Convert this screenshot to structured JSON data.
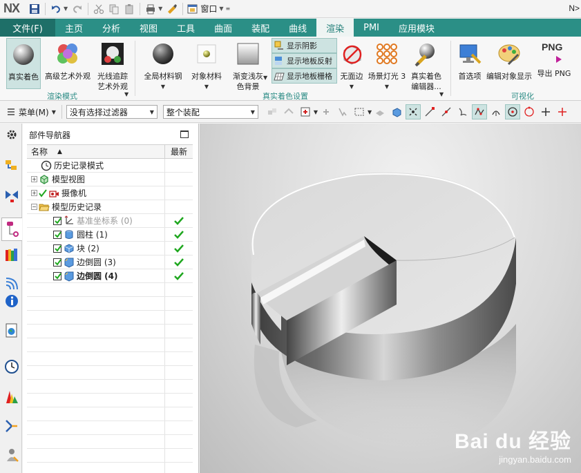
{
  "app": {
    "logo": "NX",
    "title_right": "N>"
  },
  "quick_access": {
    "window_menu": "窗口"
  },
  "tabs": [
    {
      "label": "文件(F)"
    },
    {
      "label": "主页"
    },
    {
      "label": "分析"
    },
    {
      "label": "视图"
    },
    {
      "label": "工具"
    },
    {
      "label": "曲面"
    },
    {
      "label": "装配"
    },
    {
      "label": "曲线"
    },
    {
      "label": "渲染"
    },
    {
      "label": "PMI"
    },
    {
      "label": "应用模块"
    }
  ],
  "ribbon": {
    "render_mode": {
      "true_shading": "真实着色",
      "advanced_studio_l1": "高级艺术外观",
      "ray_trace_l1": "光线追踪",
      "ray_trace_l2": "艺术外观",
      "group_label": "渲染模式"
    },
    "true_shading_settings": {
      "global_material_l1": "全局材料钢",
      "object_material_l1": "对象材料",
      "gradient_bg_l1": "渐变浅灰",
      "gradient_bg_l2": "色背景",
      "show_shadow": "显示阴影",
      "show_floor_reflection": "显示地板反射",
      "show_floor_grid": "显示地板栅格",
      "no_edges": "无面边",
      "scene_light": "场景灯光 3",
      "shading_editor_l1": "真实着色",
      "shading_editor_l2": "编辑器...",
      "group_label": "真实着色设置"
    },
    "visualize": {
      "preferences": "首选项",
      "edit_object_display": "编辑对象显示",
      "export_png_l1": "导出 PNG",
      "png_badge": "PNG",
      "group_label": "可视化"
    }
  },
  "selection_bar": {
    "menu": "菜单(M)",
    "filter": "没有选择过滤器",
    "scope": "整个装配"
  },
  "part_navigator": {
    "title": "部件导航器",
    "col_name": "名称",
    "col_latest": "最新",
    "rows": [
      {
        "label": "历史记录模式"
      },
      {
        "label": "模型视图"
      },
      {
        "label": "摄像机"
      },
      {
        "label": "模型历史记录"
      },
      {
        "label": "基准坐标系 (0)"
      },
      {
        "label": "圆柱 (1)"
      },
      {
        "label": "块 (2)"
      },
      {
        "label": "边倒圆 (3)"
      },
      {
        "label": "边倒圆 (4)"
      }
    ]
  },
  "watermark": {
    "brand": "Bai du 经验",
    "url": "jingyan.baidu.com"
  },
  "colors": {
    "tab_bar": "#2b8f86",
    "file_tab": "#1e6f68",
    "active_tab_bg": "#eef4f3",
    "group_label": "#2a8b84",
    "check_green": "#1fa71f"
  }
}
